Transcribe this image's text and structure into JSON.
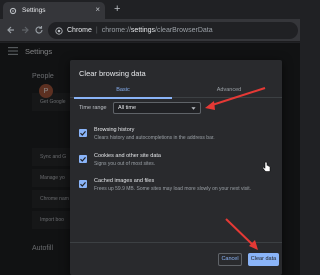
{
  "tab": {
    "title": "Settings",
    "close_glyph": "×",
    "favicon": "gear-icon"
  },
  "toolbar": {
    "new_tab_glyph": "+",
    "scheme_label": "Chrome",
    "separator": "|",
    "url_prefix": "chrome://",
    "url_host": "settings",
    "url_path": "/clearBrowserData"
  },
  "page": {
    "title": "Settings",
    "people_label": "People",
    "get_google_label": "Get Google",
    "sync_label": "Sync and G",
    "manage_label": "Manage yo",
    "chrome_name_label": "Chrome nam",
    "import_label": "Import boo",
    "autofill_label": "Autofill",
    "avatar_letter": "P"
  },
  "dialog": {
    "title": "Clear browsing data",
    "tabs": [
      {
        "label": "Basic"
      },
      {
        "label": "Advanced"
      }
    ],
    "time_range_label": "Time range",
    "time_range_value": "All time",
    "options": [
      {
        "title": "Browsing history",
        "description": "Clears history and autocompletions in the address bar."
      },
      {
        "title": "Cookies and other site data",
        "description": "Signs you out of most sites."
      },
      {
        "title": "Cached images and files",
        "description": "Frees up 59.9 MB. Some sites may load more slowly on your next visit."
      }
    ],
    "cancel_label": "Cancel",
    "clear_label": "Clear data"
  },
  "colors": {
    "accent": "#8ab4f8",
    "annotation": "#e53935",
    "background": "#202124",
    "dialog": "#292a2d"
  }
}
